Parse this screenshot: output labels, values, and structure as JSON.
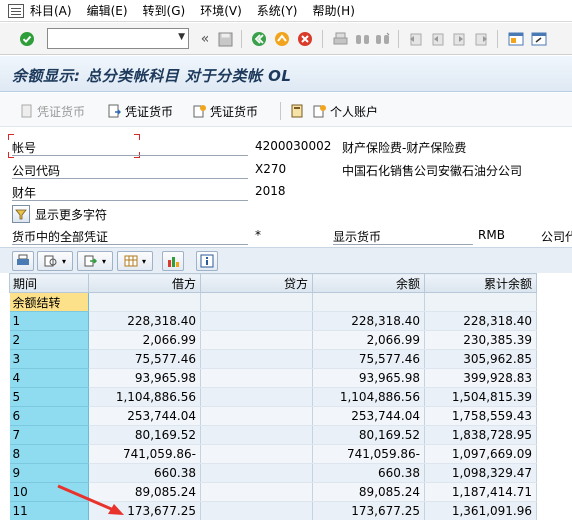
{
  "menu": {
    "items": [
      "科目(A)",
      "编辑(E)",
      "转到(G)",
      "环境(V)",
      "系统(Y)",
      "帮助(H)"
    ]
  },
  "toolbar": {
    "command_value": "",
    "icons": [
      "enter-icon",
      "save-icon",
      "back-icon",
      "exit-icon",
      "cancel-icon",
      "print-icon",
      "find-icon",
      "find-next-icon",
      "first-page-icon",
      "prev-page-icon",
      "next-page-icon",
      "last-page-icon",
      "create-session-icon",
      "shortcut-icon"
    ]
  },
  "title": "余额显示: 总分类帐科目 对于分类帐 OL",
  "app_toolbar": {
    "doc_currency": "凭证货币",
    "doc_currency2": "凭证货币",
    "doc_currency3": "凭证货币",
    "personal_account": "个人账户"
  },
  "header": {
    "account_label": "帐号",
    "account_value": "4200030002",
    "account_desc": "财产保险费-财产保险费",
    "company_label": "公司代码",
    "company_value": "X270",
    "company_desc": "中国石化销售公司安徽石油分公司",
    "year_label": "财年",
    "year_value": "2018",
    "more_chars": "显示更多字符",
    "all_docs_label": "货币中的全部凭证",
    "all_docs_value": "*",
    "display_currency_label": "显示货币",
    "display_currency_value": "RMB",
    "company_currency_label": "公司代"
  },
  "grid": {
    "columns": [
      "期间",
      "借方",
      "贷方",
      "余额",
      "累计余额"
    ],
    "carry_label": "余额结转",
    "rows": [
      {
        "period": "1",
        "debit": "228,318.40",
        "credit": "",
        "balance": "228,318.40",
        "cumulative": "228,318.40"
      },
      {
        "period": "2",
        "debit": "2,066.99",
        "credit": "",
        "balance": "2,066.99",
        "cumulative": "230,385.39"
      },
      {
        "period": "3",
        "debit": "75,577.46",
        "credit": "",
        "balance": "75,577.46",
        "cumulative": "305,962.85"
      },
      {
        "period": "4",
        "debit": "93,965.98",
        "credit": "",
        "balance": "93,965.98",
        "cumulative": "399,928.83"
      },
      {
        "period": "5",
        "debit": "1,104,886.56",
        "credit": "",
        "balance": "1,104,886.56",
        "cumulative": "1,504,815.39"
      },
      {
        "period": "6",
        "debit": "253,744.04",
        "credit": "",
        "balance": "253,744.04",
        "cumulative": "1,758,559.43"
      },
      {
        "period": "7",
        "debit": "80,169.52",
        "credit": "",
        "balance": "80,169.52",
        "cumulative": "1,838,728.95"
      },
      {
        "period": "8",
        "debit": "741,059.86-",
        "credit": "",
        "balance": "741,059.86-",
        "cumulative": "1,097,669.09"
      },
      {
        "period": "9",
        "debit": "660.38",
        "credit": "",
        "balance": "660.38",
        "cumulative": "1,098,329.47"
      },
      {
        "period": "10",
        "debit": "89,085.24",
        "credit": "",
        "balance": "89,085.24",
        "cumulative": "1,187,414.71"
      },
      {
        "period": "11",
        "debit": "173,677.25",
        "credit": "",
        "balance": "173,677.25",
        "cumulative": "1,361,091.96"
      }
    ]
  },
  "colors": {
    "period_cell": "#8fdcf0",
    "carry_cell": "#fde18a",
    "arrow": "#e8322c",
    "title_text": "#1d3a5c"
  }
}
